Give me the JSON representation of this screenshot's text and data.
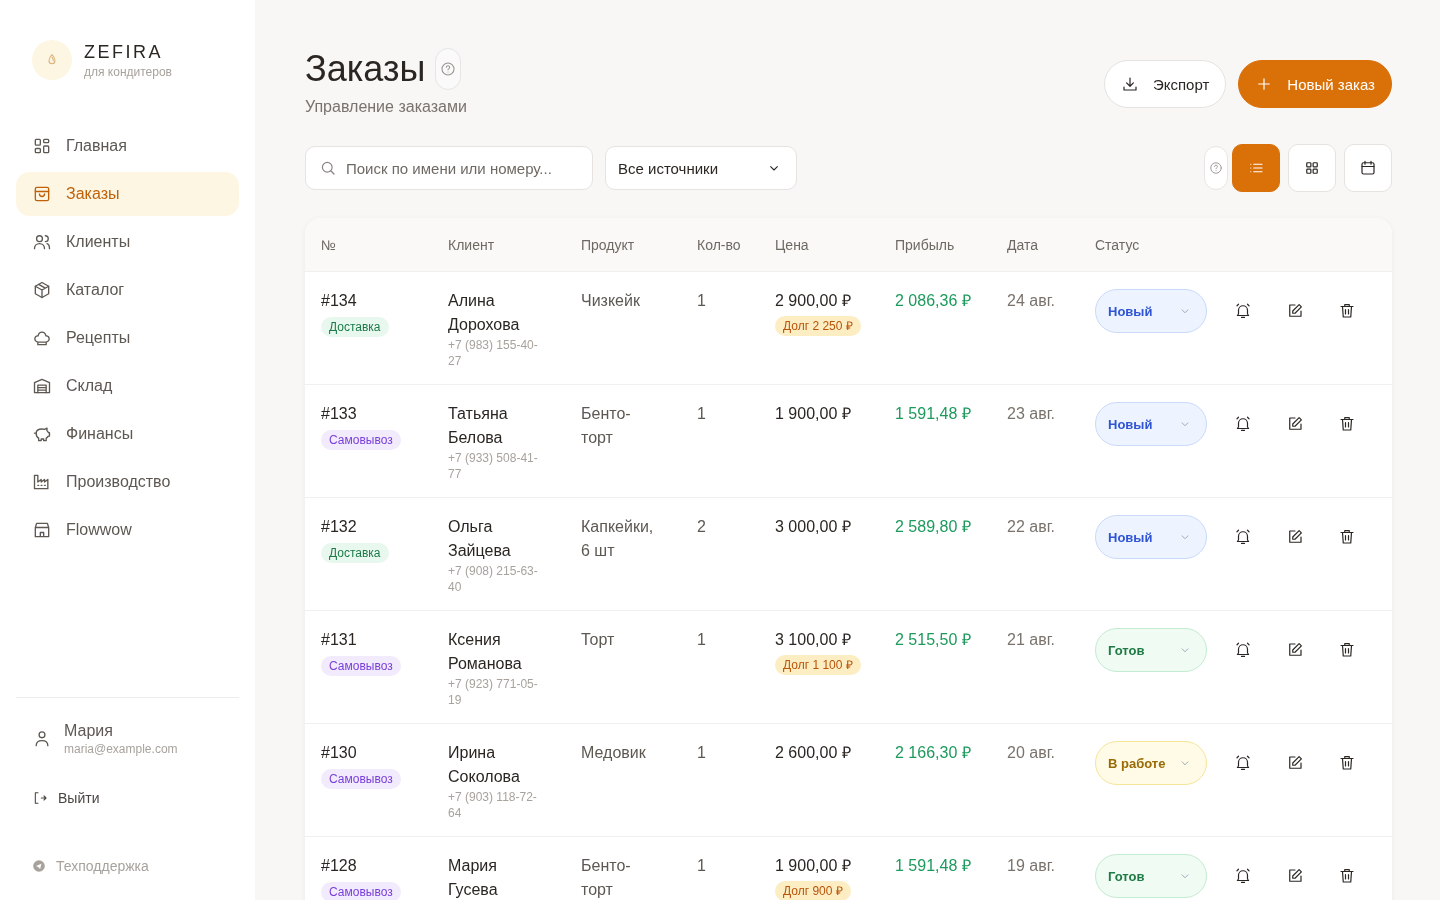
{
  "brand": {
    "name": "ZEFIRA",
    "tagline": "для кондитеров"
  },
  "sidebar": {
    "items": [
      {
        "label": "Главная",
        "selected": false
      },
      {
        "label": "Заказы",
        "selected": true
      },
      {
        "label": "Клиенты",
        "selected": false
      },
      {
        "label": "Каталог",
        "selected": false
      },
      {
        "label": "Рецепты",
        "selected": false
      },
      {
        "label": "Склад",
        "selected": false
      },
      {
        "label": "Финансы",
        "selected": false
      },
      {
        "label": "Производство",
        "selected": false
      },
      {
        "label": "Flowwow",
        "selected": false
      }
    ],
    "user": {
      "name": "Мария",
      "email": "maria@example.com"
    },
    "logout": "Выйти",
    "support": "Техподдержка"
  },
  "header": {
    "title": "Заказы",
    "subtitle": "Управление заказами",
    "export_button": "Экспорт",
    "new_order_button": "Новый заказ"
  },
  "toolbar": {
    "search": {
      "placeholder": "Поиск по имени или номеру..."
    },
    "source_filter": "Все источники",
    "view_buttons": [
      {
        "kind": "list",
        "selected": true
      },
      {
        "kind": "grid",
        "selected": false
      },
      {
        "kind": "calendar",
        "selected": false
      }
    ]
  },
  "table": {
    "columns": [
      "№",
      "Клиент",
      "Продукт",
      "Кол-во",
      "Цена",
      "Прибыль",
      "Дата",
      "Статус"
    ],
    "rows": [
      {
        "number": "#134",
        "delivery": {
          "kind": "delivery",
          "label": "Доставка"
        },
        "client": "Алина Дорохова",
        "phone": "+7 (983) 155-40-27",
        "product": "Чизкейк",
        "quantity": "1",
        "price": "2 900,00 ₽",
        "debt": "Долг 2 250 ₽",
        "profit": "2 086,36 ₽",
        "date": "24 авг.",
        "status": {
          "kind": "new",
          "label": "Новый"
        }
      },
      {
        "number": "#133",
        "delivery": {
          "kind": "pickup",
          "label": "Самовывоз"
        },
        "client": "Татьяна Белова",
        "phone": "+7 (933) 508-41-77",
        "product": "Бенто-торт",
        "quantity": "1",
        "price": "1 900,00 ₽",
        "profit": "1 591,48 ₽",
        "date": "23 авг.",
        "status": {
          "kind": "new",
          "label": "Новый"
        }
      },
      {
        "number": "#132",
        "delivery": {
          "kind": "delivery",
          "label": "Доставка"
        },
        "client": "Ольга Зайцева",
        "phone": "+7 (908) 215-63-40",
        "product": "Капкейки, 6 шт",
        "quantity": "2",
        "price": "3 000,00 ₽",
        "profit": "2 589,80 ₽",
        "date": "22 авг.",
        "status": {
          "kind": "new",
          "label": "Новый"
        }
      },
      {
        "number": "#131",
        "delivery": {
          "kind": "pickup",
          "label": "Самовывоз"
        },
        "client": "Ксения Романова",
        "phone": "+7 (923) 771-05-19",
        "product": "Торт",
        "quantity": "1",
        "price": "3 100,00 ₽",
        "debt": "Долг 1 100 ₽",
        "profit": "2 515,50 ₽",
        "date": "21 авг.",
        "status": {
          "kind": "ready",
          "label": "Готов"
        }
      },
      {
        "number": "#130",
        "delivery": {
          "kind": "pickup",
          "label": "Самовывоз"
        },
        "client": "Ирина Соколова",
        "phone": "+7 (903) 118-72-64",
        "product": "Медовик",
        "quantity": "1",
        "price": "2 600,00 ₽",
        "profit": "2 166,30 ₽",
        "date": "20 авг.",
        "status": {
          "kind": "progress",
          "label": "В работе"
        }
      },
      {
        "number": "#128",
        "delivery": {
          "kind": "pickup",
          "label": "Самовывоз"
        },
        "client": "Мария Гусева",
        "product": "Бенто-торт",
        "quantity": "1",
        "price": "1 900,00 ₽",
        "debt": "Долг 900 ₽",
        "profit": "1 591,48 ₽",
        "date": "19 авг.",
        "status": {
          "kind": "ready",
          "label": "Готов"
        }
      }
    ]
  }
}
